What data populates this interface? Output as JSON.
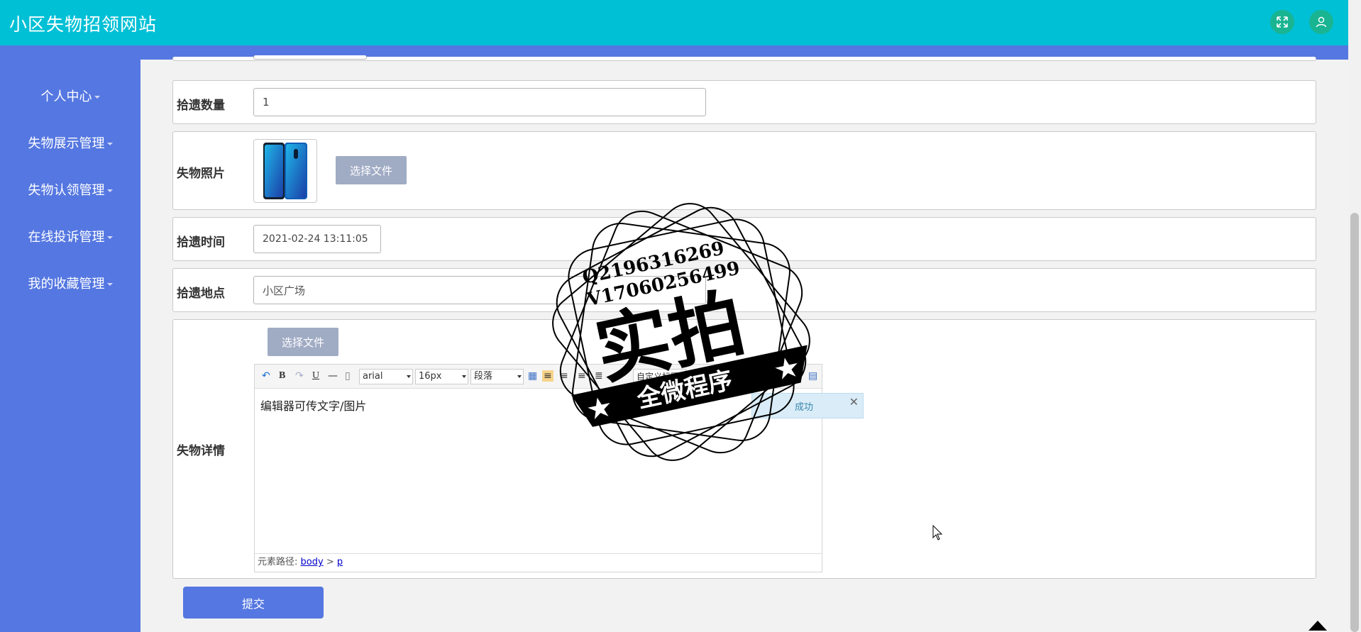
{
  "app": {
    "title": "小区失物招领网站"
  },
  "header": {
    "fullscreen_icon": "fullscreen-icon",
    "user_icon": "user-icon"
  },
  "sidebar": {
    "items": [
      {
        "label": "个人中心"
      },
      {
        "label": "失物展示管理"
      },
      {
        "label": "失物认领管理"
      },
      {
        "label": "在线投诉管理"
      },
      {
        "label": "我的收藏管理"
      }
    ]
  },
  "form": {
    "quantity": {
      "label": "拾遗数量",
      "value": "1"
    },
    "photo": {
      "label": "失物照片",
      "button": "选择文件"
    },
    "time": {
      "label": "拾遗时间",
      "value": "2021-02-24 13:11:05"
    },
    "location": {
      "label": "拾遗地点",
      "value": "小区广场"
    },
    "details": {
      "label": "失物详情",
      "button": "选择文件",
      "editor_text": "编辑器可传文字/图片",
      "font_family": "arial",
      "font_size": "16px",
      "paragraph": "段落",
      "custom_heading": "自定义标题",
      "notice": "成功",
      "path_label": "元素路径:",
      "path_body": "body",
      "path_sep": ">",
      "path_p": "p"
    },
    "submit_label": "提交"
  },
  "watermark": {
    "line1": "Q2196316269",
    "line2": "V17060256499",
    "main": "实拍",
    "ribbon": "全微程序"
  },
  "colors": {
    "header": "#00c0d6",
    "sidebar": "#5577e1",
    "icon_bg": "#19b491",
    "file_button": "#a0abc4"
  }
}
